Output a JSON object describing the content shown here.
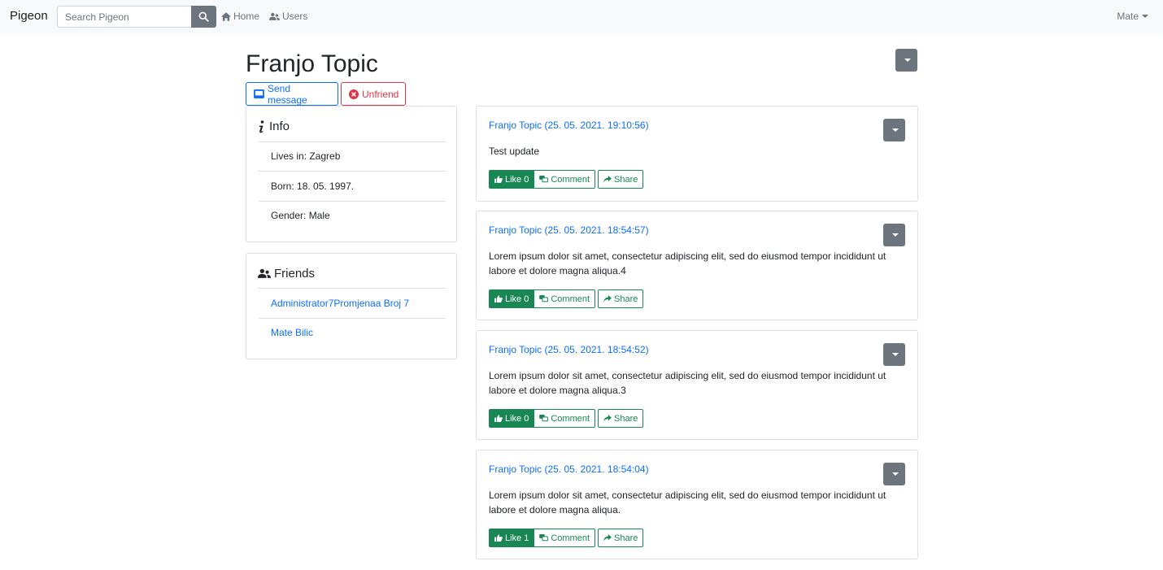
{
  "navbar": {
    "brand": "Pigeon",
    "search_placeholder": "Search Pigeon",
    "home_label": "Home",
    "users_label": "Users",
    "user_menu_label": "Mate"
  },
  "profile": {
    "name": "Franjo Topic",
    "send_message_label": "Send message",
    "unfriend_label": "Unfriend"
  },
  "info": {
    "title": "Info",
    "items": [
      "Lives in: Zagreb",
      "Born: 18. 05. 1997.",
      "Gender: Male"
    ]
  },
  "friends": {
    "title": "Friends",
    "items": [
      "Administrator7Promjenaa Broj 7",
      "Mate Bilic"
    ]
  },
  "posts": [
    {
      "author": "Franjo Topic",
      "timestamp": "(25. 05. 2021. 19:10:56)",
      "text": "Test update",
      "like_label": "Like 0",
      "comment_label": "Comment",
      "share_label": "Share"
    },
    {
      "author": "Franjo Topic",
      "timestamp": "(25. 05. 2021. 18:54:57)",
      "text": "Lorem ipsum dolor sit amet, consectetur adipiscing elit, sed do eiusmod tempor incididunt ut labore et dolore magna aliqua.4",
      "like_label": "Like 0",
      "comment_label": "Comment",
      "share_label": "Share"
    },
    {
      "author": "Franjo Topic",
      "timestamp": "(25. 05. 2021. 18:54:52)",
      "text": "Lorem ipsum dolor sit amet, consectetur adipiscing elit, sed do eiusmod tempor incididunt ut labore et dolore magna aliqua.3",
      "like_label": "Like 0",
      "comment_label": "Comment",
      "share_label": "Share"
    },
    {
      "author": "Franjo Topic",
      "timestamp": "(25. 05. 2021. 18:54:04)",
      "text": "Lorem ipsum dolor sit amet, consectetur adipiscing elit, sed do eiusmod tempor incididunt ut labore et dolore magna aliqua.",
      "like_label": "Like 1",
      "comment_label": "Comment",
      "share_label": "Share"
    }
  ],
  "colors": {
    "primary": "#0d6efd",
    "danger": "#dc3545",
    "success": "#198754",
    "secondary": "#6c757d",
    "navbar_bg": "#f8f9fa"
  },
  "icons": {
    "search": "search-icon",
    "home": "home-icon",
    "users": "users-icon",
    "message": "envelope-icon",
    "unfriend": "times-circle-icon",
    "info": "info-icon",
    "like": "thumbs-up-icon",
    "comment": "comments-icon",
    "share": "share-icon",
    "dropdown": "caret-down-icon"
  }
}
